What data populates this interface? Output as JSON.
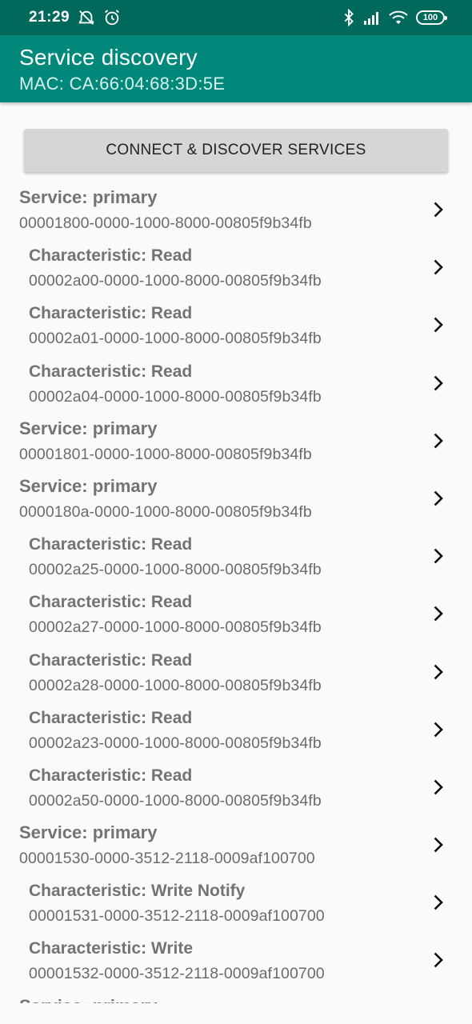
{
  "status_bar": {
    "time": "21:29",
    "battery": "100",
    "icons": [
      "alarm-off-icon",
      "alarm-icon",
      "bluetooth-icon",
      "signal-icon",
      "wifi-icon",
      "battery-icon"
    ]
  },
  "app_bar": {
    "title": "Service discovery",
    "subtitle": "MAC: CA:66:04:68:3D:5E",
    "color": "#00897b",
    "status_color": "#00695c"
  },
  "connect_button": {
    "label": "CONNECT & DISCOVER SERVICES"
  },
  "items": [
    {
      "kind": "service",
      "title": "Service: primary",
      "uuid": "00001800-0000-1000-8000-00805f9b34fb"
    },
    {
      "kind": "characteristic",
      "title": "Characteristic: Read",
      "uuid": "00002a00-0000-1000-8000-00805f9b34fb"
    },
    {
      "kind": "characteristic",
      "title": "Characteristic: Read",
      "uuid": "00002a01-0000-1000-8000-00805f9b34fb"
    },
    {
      "kind": "characteristic",
      "title": "Characteristic: Read",
      "uuid": "00002a04-0000-1000-8000-00805f9b34fb"
    },
    {
      "kind": "service",
      "title": "Service: primary",
      "uuid": "00001801-0000-1000-8000-00805f9b34fb"
    },
    {
      "kind": "service",
      "title": "Service: primary",
      "uuid": "0000180a-0000-1000-8000-00805f9b34fb"
    },
    {
      "kind": "characteristic",
      "title": "Characteristic: Read",
      "uuid": "00002a25-0000-1000-8000-00805f9b34fb"
    },
    {
      "kind": "characteristic",
      "title": "Characteristic: Read",
      "uuid": "00002a27-0000-1000-8000-00805f9b34fb"
    },
    {
      "kind": "characteristic",
      "title": "Characteristic: Read",
      "uuid": "00002a28-0000-1000-8000-00805f9b34fb"
    },
    {
      "kind": "characteristic",
      "title": "Characteristic: Read",
      "uuid": "00002a23-0000-1000-8000-00805f9b34fb"
    },
    {
      "kind": "characteristic",
      "title": "Characteristic: Read",
      "uuid": "00002a50-0000-1000-8000-00805f9b34fb"
    },
    {
      "kind": "service",
      "title": "Service: primary",
      "uuid": "00001530-0000-3512-2118-0009af100700"
    },
    {
      "kind": "characteristic",
      "title": "Characteristic: Write Notify",
      "uuid": "00001531-0000-3512-2118-0009af100700"
    },
    {
      "kind": "characteristic",
      "title": "Characteristic: Write",
      "uuid": "00001532-0000-3512-2118-0009af100700"
    },
    {
      "kind": "service",
      "title": "Service: primary",
      "uuid": ""
    }
  ]
}
